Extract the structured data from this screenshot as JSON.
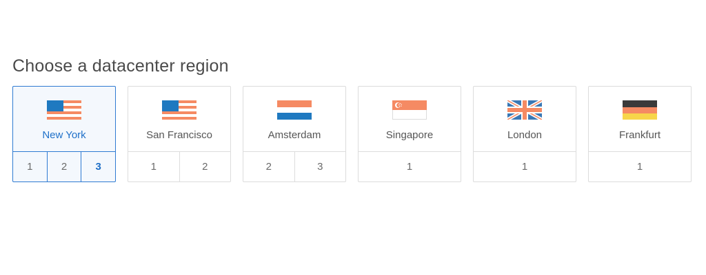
{
  "heading": "Choose a datacenter region",
  "regions": [
    {
      "name": "New York",
      "flag": "us-flag-icon",
      "datacenters": [
        "1",
        "2",
        "3"
      ],
      "selected": true,
      "active_datacenter": "3"
    },
    {
      "name": "San Francisco",
      "flag": "us-flag-icon",
      "datacenters": [
        "1",
        "2"
      ],
      "selected": false
    },
    {
      "name": "Amsterdam",
      "flag": "nl-flag-icon",
      "datacenters": [
        "2",
        "3"
      ],
      "selected": false
    },
    {
      "name": "Singapore",
      "flag": "sg-flag-icon",
      "datacenters": [
        "1"
      ],
      "selected": false
    },
    {
      "name": "London",
      "flag": "uk-flag-icon",
      "datacenters": [
        "1"
      ],
      "selected": false
    },
    {
      "name": "Frankfurt",
      "flag": "de-flag-icon",
      "datacenters": [
        "1"
      ],
      "selected": false
    }
  ],
  "colors": {
    "selected_border": "#2e7ad2",
    "selected_background": "#f4f8fd",
    "selected_text": "#2071c9",
    "card_border": "#dcdcdc",
    "heading_text": "#4a4a4a",
    "flag_orange": "#f58a63",
    "flag_blue": "#1f79c0"
  }
}
